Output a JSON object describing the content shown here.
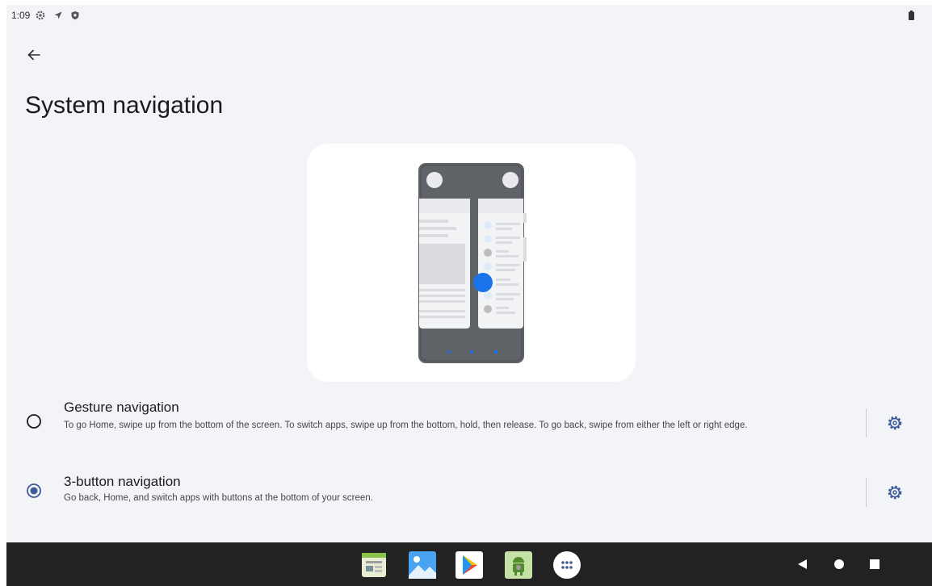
{
  "status_bar": {
    "time": "1:09",
    "icons": [
      "settings-gear-icon",
      "location-arrow-icon",
      "shield-icon",
      "battery-icon"
    ]
  },
  "header": {
    "back_icon": "arrow-back-icon",
    "title": "System navigation"
  },
  "illustration": {
    "description_icon": "gesture-navigation-animation",
    "accent_color": "#1a73e8"
  },
  "options": [
    {
      "id": "gesture",
      "title": "Gesture navigation",
      "summary": "To go Home, swipe up from the bottom of the screen. To switch apps, swipe up from the bottom, hold, then release. To go back, swipe from either the left or right edge.",
      "selected": false,
      "settings_icon": "gear-icon"
    },
    {
      "id": "three_button",
      "title": "3-button navigation",
      "summary": "Go back, Home, and switch apps with buttons at the bottom of your screen.",
      "selected": true,
      "settings_icon": "gear-icon"
    }
  ],
  "taskbar": {
    "apps": [
      "files-app-icon",
      "gallery-app-icon",
      "play-store-icon",
      "android-app-icon",
      "all-apps-icon"
    ],
    "nav_buttons": [
      "back-triangle-icon",
      "home-circle-icon",
      "recents-square-icon"
    ]
  },
  "colors": {
    "background": "#f3f4f8",
    "radio_selected": "#3d5a9a",
    "taskbar": "#222222"
  }
}
